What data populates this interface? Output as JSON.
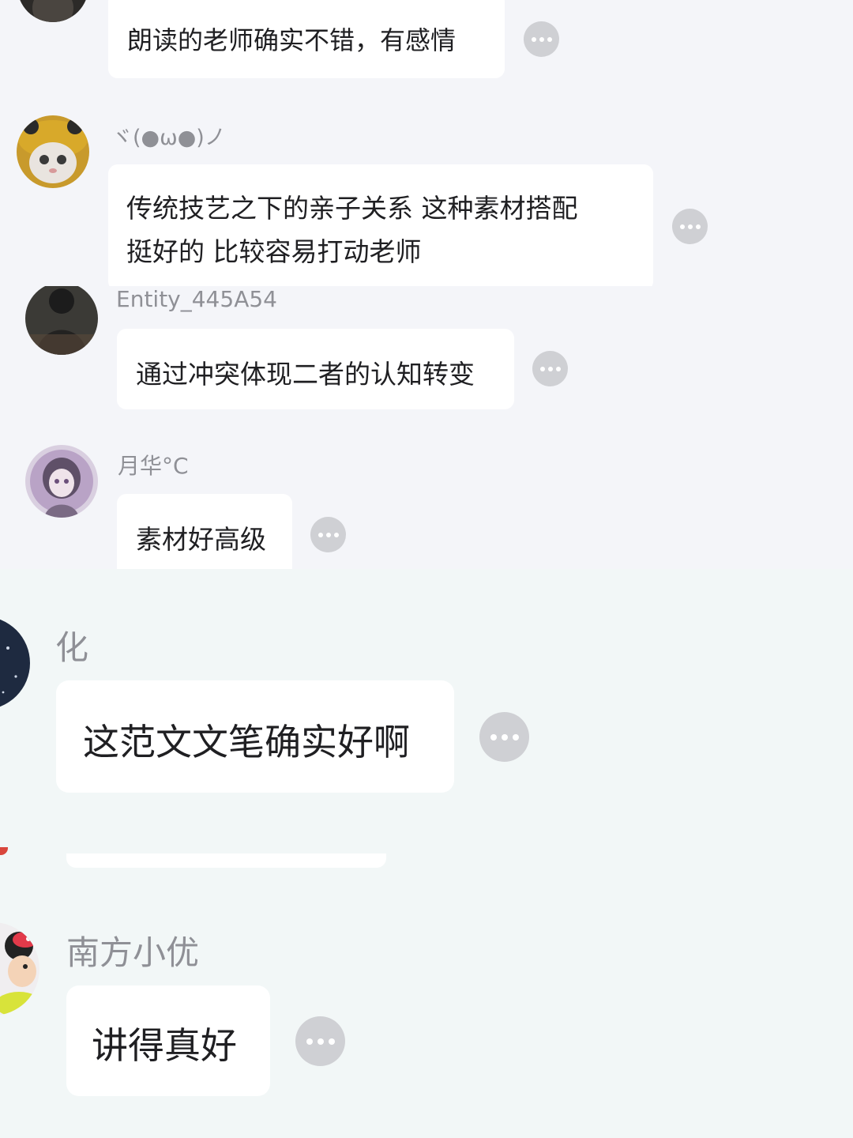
{
  "comments": [
    {
      "username": "",
      "avatar_icon": "dark-photo-avatar-icon",
      "lines": [
        "朗读的老师确实不错，有感情"
      ],
      "more_icon": "more-options-icon"
    },
    {
      "username": "ヾ(●ω●)ノ",
      "avatar_icon": "cat-in-hat-avatar-icon",
      "lines": [
        "传统技艺之下的亲子关系 这种素材搭配",
        "挺好的 比较容易打动老师"
      ],
      "more_icon": "more-options-icon"
    },
    {
      "username": "Entity_445A54",
      "avatar_icon": "dark-figure-avatar-icon",
      "lines": [
        "通过冲突体现二者的认知转变"
      ],
      "more_icon": "more-options-icon"
    },
    {
      "username": "月华°C",
      "avatar_icon": "anime-girl-avatar-icon",
      "lines": [
        "素材好高级"
      ],
      "more_icon": "more-options-icon"
    },
    {
      "username": "化",
      "avatar_icon": "night-sky-avatar-icon",
      "lines": [
        "这范文文笔确实好啊"
      ],
      "more_icon": "more-options-icon"
    },
    {
      "username": "南方小优",
      "avatar_icon": "cartoon-mouse-avatar-icon",
      "lines": [
        "讲得真好"
      ],
      "more_icon": "more-options-icon"
    }
  ],
  "colors": {
    "background": "#f4f5f9",
    "background_lower": "#f2f7f7",
    "bubble": "#ffffff",
    "username": "#8f9096",
    "text": "#1f1f22",
    "more_button": "#cfd0d4"
  }
}
